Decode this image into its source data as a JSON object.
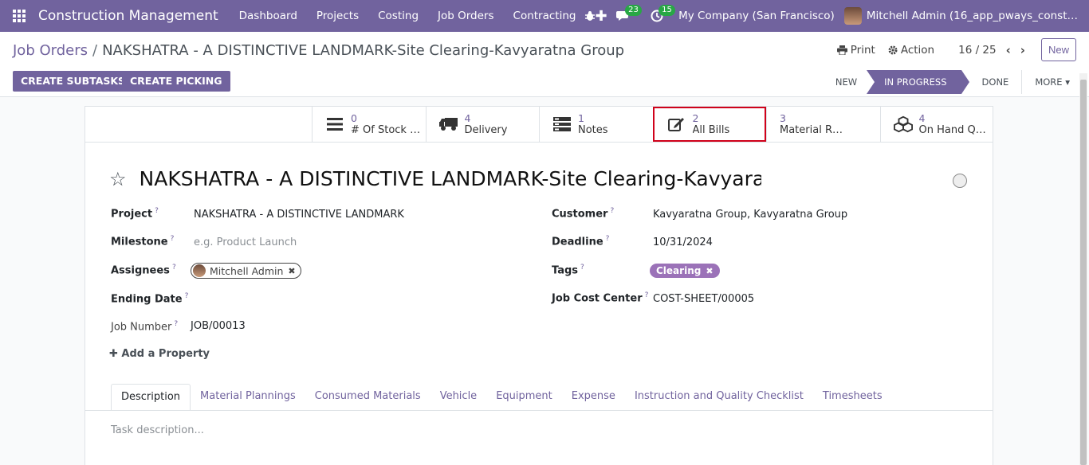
{
  "topbar": {
    "brand": "Construction Management",
    "menu": [
      "Dashboard",
      "Projects",
      "Costing",
      "Job Orders",
      "Contracting"
    ],
    "plus": "✚",
    "chat_count": "23",
    "activity_count": "15",
    "company": "My Company (San Francisco)",
    "user": "Mitchell Admin (16_app_pways_const…"
  },
  "control": {
    "breadcrumb_parent": "Job Orders",
    "breadcrumb_sep": "/",
    "breadcrumb_current": "NAKSHATRA - A DISTINCTIVE LANDMARK-Site Clearing-Kavyaratna Group",
    "print": "Print",
    "action": "Action",
    "pager": "16 / 25",
    "new": "New",
    "create_subtasks": "CREATE SUBTASKS",
    "create_picking": "CREATE PICKING",
    "stages": [
      "NEW",
      "IN PROGRESS",
      "DONE"
    ],
    "active_stage": "IN PROGRESS",
    "more": "MORE"
  },
  "smart_buttons": [
    {
      "count": "0",
      "label": "# Of Stock …",
      "icon": "list-icon"
    },
    {
      "count": "4",
      "label": "Delivery",
      "icon": "truck-icon"
    },
    {
      "count": "1",
      "label": "Notes",
      "icon": "notes-icon"
    },
    {
      "count": "2",
      "label": "All Bills",
      "icon": "edit-icon"
    },
    {
      "count": "3",
      "label": "Material R…",
      "icon": "none"
    },
    {
      "count": "4",
      "label": "On Hand Q…",
      "icon": "cubes-icon"
    }
  ],
  "record": {
    "title": "NAKSHATRA - A DISTINCTIVE LANDMARK-Site Clearing-Kavyaratna Group",
    "fields": {
      "project_label": "Project",
      "project_value": "NAKSHATRA - A DISTINCTIVE LANDMARK",
      "milestone_label": "Milestone",
      "milestone_placeholder": "e.g. Product Launch",
      "assignees_label": "Assignees",
      "assignee": "Mitchell Admin",
      "ending_date_label": "Ending Date",
      "job_number_label": "Job Number",
      "job_number_value": "JOB/00013",
      "customer_label": "Customer",
      "customer_value": "Kavyaratna Group, Kavyaratna Group",
      "deadline_label": "Deadline",
      "deadline_value": "10/31/2024",
      "tags_label": "Tags",
      "tag": "Clearing",
      "cost_center_label": "Job Cost Center",
      "cost_center_value": "COST-SHEET/00005",
      "help": "?"
    },
    "add_property": "Add a Property"
  },
  "tabs": [
    "Description",
    "Material Plannings",
    "Consumed Materials",
    "Vehicle",
    "Equipment",
    "Expense",
    "Instruction and Quality Checklist",
    "Timesheets"
  ],
  "description_placeholder": "Task description..."
}
